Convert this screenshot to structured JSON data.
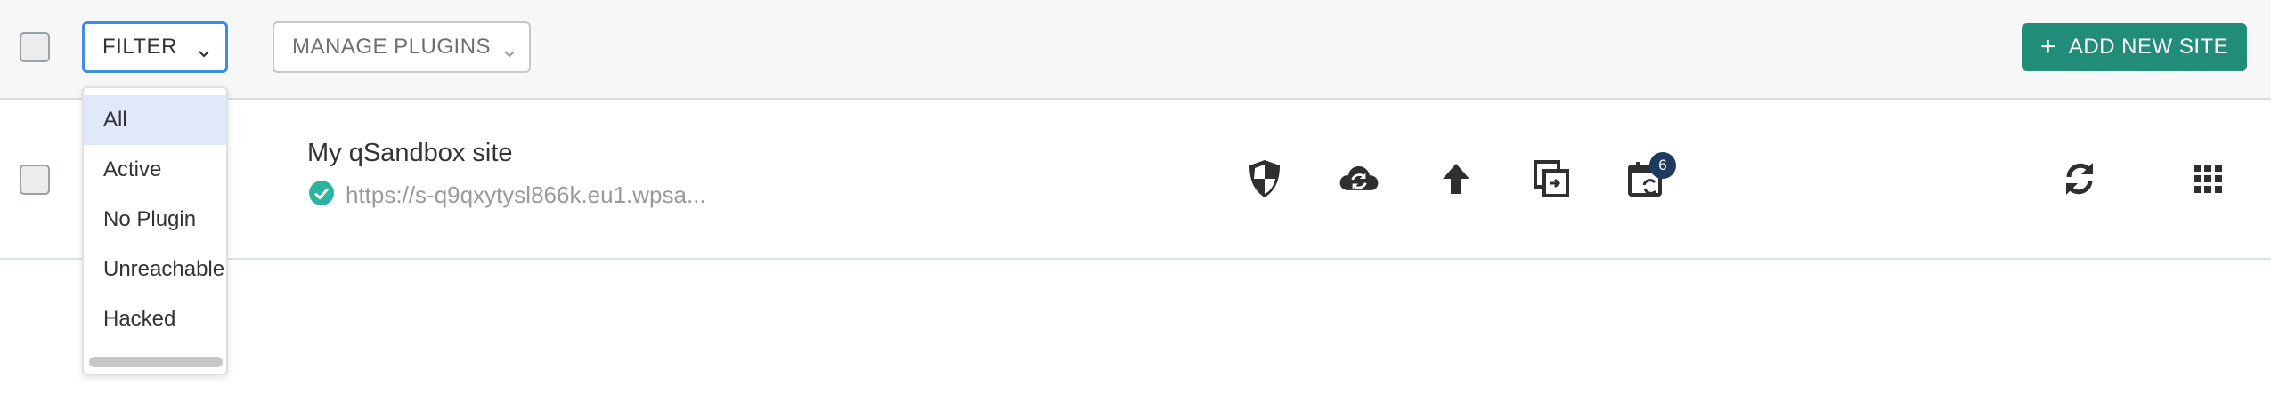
{
  "toolbar": {
    "filter_label": "FILTER",
    "manage_plugins_label": "MANAGE PLUGINS",
    "add_site_label": "ADD NEW SITE",
    "add_site_icon": "plus-icon"
  },
  "filter_dropdown": {
    "items": [
      {
        "label": "All",
        "selected": true
      },
      {
        "label": "Active",
        "selected": false
      },
      {
        "label": "No Plugin",
        "selected": false
      },
      {
        "label": "Unreachable",
        "selected": false
      },
      {
        "label": "Hacked",
        "selected": false
      }
    ]
  },
  "site": {
    "title": "My qSandbox site",
    "url": "https://s-q9qxytysl866k.eu1.wpsa...",
    "status": "connected",
    "actions": [
      {
        "icon": "security-shield-icon"
      },
      {
        "icon": "cloud-sync-icon"
      },
      {
        "icon": "upload-arrow-icon"
      },
      {
        "icon": "clone-icon"
      },
      {
        "icon": "scheduled-calendar-icon",
        "badge": "6"
      }
    ],
    "refresh_icon": "refresh-icon",
    "menu_icon": "grid-menu-icon"
  },
  "colors": {
    "accent_green": "#218c78",
    "focus_blue": "#3d8fe0",
    "status_teal": "#2bb5a0",
    "badge_navy": "#1e3a5f",
    "selected_bg": "#dfe9f9"
  }
}
